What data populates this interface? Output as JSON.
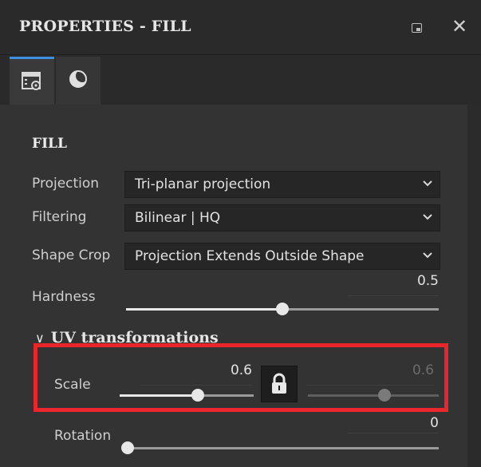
{
  "panel": {
    "title": "PROPERTIES - FILL",
    "tabs": [
      {
        "name": "properties",
        "icon": "properties-gear-icon",
        "active": true
      },
      {
        "name": "material",
        "icon": "material-sphere-icon",
        "active": false
      }
    ]
  },
  "fill": {
    "section_title": "FILL",
    "projection": {
      "label": "Projection",
      "value": "Tri-planar projection"
    },
    "filtering": {
      "label": "Filtering",
      "value": "Bilinear | HQ"
    },
    "shape_crop": {
      "label": "Shape Crop",
      "value": "Projection Extends Outside Shape"
    },
    "hardness": {
      "label": "Hardness",
      "value": "0.5",
      "level": 0.5
    }
  },
  "uv": {
    "section_title": "UV transformations",
    "scale": {
      "label": "Scale",
      "value_u": "0.6",
      "value_v": "0.6",
      "locked": true
    },
    "rotation": {
      "label": "Rotation",
      "value": "0",
      "level": 0
    }
  },
  "colors": {
    "accent": "#3d8fe0",
    "highlight": "#e8262b"
  }
}
